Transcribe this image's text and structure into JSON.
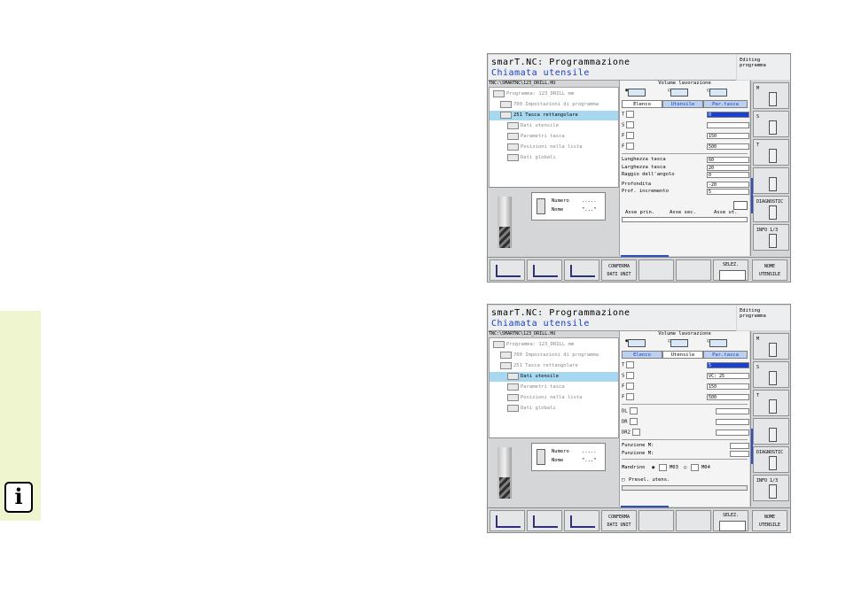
{
  "colors": {
    "sidebar": "#eef5cf",
    "accent": "#1a40c0",
    "selection": "#a8d8f0",
    "highlight_field": "#1a40d0"
  },
  "icons": [
    "info-icon",
    "tool-icon",
    "ribbon-icon",
    "spindle-icon",
    "drill-icon"
  ],
  "screens": [
    {
      "title": "smarT.NC: Programmazione",
      "subtitle": "Chiamata utensile",
      "mode": "Editing programma",
      "path": "TNC:\\SMARTNC\\123_DRILL.HU",
      "tree": [
        {
          "text": "Programma: 123_DRILL mm",
          "dim": true,
          "selected": false,
          "indent": 0
        },
        {
          "text": "700 Impostazioni di programma",
          "dim": true,
          "selected": false,
          "indent": 1
        },
        {
          "text": "251 Tasca rettangolare",
          "dim": false,
          "selected": true,
          "indent": 1
        },
        {
          "text": "Dati utensile",
          "dim": true,
          "selected": false,
          "indent": 2
        },
        {
          "text": "Parametri tasca",
          "dim": true,
          "selected": false,
          "indent": 2
        },
        {
          "text": "Posizioni nella lista",
          "dim": true,
          "selected": false,
          "indent": 2
        },
        {
          "text": "Dati globali",
          "dim": true,
          "selected": false,
          "indent": 2
        }
      ],
      "toolinfo": {
        "numero_label": "Numero",
        "numero_value": ".....",
        "nome_label": "Nome",
        "nome_value": "\"...\""
      },
      "volume_label": "Volume lavorazione",
      "tabs": [
        "Elenco",
        "Utensile",
        "Par.tasca"
      ],
      "active_tab": 0,
      "fields": [
        {
          "label": "T",
          "value": "0",
          "hl": true
        },
        {
          "label": "S",
          "value": ""
        },
        {
          "label": "F",
          "value": "150"
        },
        {
          "label": "F",
          "value": "500"
        }
      ],
      "params": [
        {
          "label": "Lunghezza tasca",
          "value": "60"
        },
        {
          "label": "Larghezza tasca",
          "value": "20"
        },
        {
          "label": "Raggio dell'angolo",
          "value": "0"
        },
        {
          "label": "Profondita",
          "value": "-20"
        },
        {
          "label": "Prof. incremento",
          "value": "5"
        }
      ],
      "axes": [
        "Asse prin.",
        "Asse sec.",
        "Asse ut."
      ],
      "right_buttons": [
        "M",
        "S",
        "T",
        "",
        "DIAGNOSTIC",
        "INFO 1/3"
      ],
      "bottom": {
        "confirm_l1": "CONFERMA",
        "confirm_l2": "DATI UNIT",
        "select": "SELEZ.",
        "name_l1": "NOME",
        "name_l2": "UTENSILE"
      }
    },
    {
      "title": "smarT.NC: Programmazione",
      "subtitle": "Chiamata utensile",
      "mode": "Editing programma",
      "path": "TNC:\\SMARTNC\\123_DRILL.HU",
      "tree": [
        {
          "text": "Programma: 123_DRILL mm",
          "dim": true,
          "selected": false,
          "indent": 0
        },
        {
          "text": "700 Impostazioni di programma",
          "dim": true,
          "selected": false,
          "indent": 1
        },
        {
          "text": "251 Tasca rettangolare",
          "dim": true,
          "selected": false,
          "indent": 1
        },
        {
          "text": "Dati utensile",
          "dim": false,
          "selected": true,
          "indent": 2
        },
        {
          "text": "Parametri tasca",
          "dim": true,
          "selected": false,
          "indent": 2
        },
        {
          "text": "Posizioni nella lista",
          "dim": true,
          "selected": false,
          "indent": 2
        },
        {
          "text": "Dati globali",
          "dim": true,
          "selected": false,
          "indent": 2
        }
      ],
      "toolinfo": {
        "numero_label": "Numero",
        "numero_value": ".....",
        "nome_label": "Nome",
        "nome_value": "\"...\""
      },
      "volume_label": "Volume lavorazione",
      "tabs": [
        "Elenco",
        "Utensile",
        "Par.tasca"
      ],
      "active_tab": 1,
      "fields": [
        {
          "label": "T",
          "value": "5",
          "hl": true
        },
        {
          "label": "S",
          "value": "VC: 25"
        },
        {
          "label": "F",
          "value": "150"
        },
        {
          "label": "F",
          "value": "500"
        }
      ],
      "offsets": [
        {
          "label": "DL"
        },
        {
          "label": "DR"
        },
        {
          "label": "DR2"
        }
      ],
      "funcs": [
        {
          "label": "Funzione M:"
        },
        {
          "label": "Funzione M:"
        }
      ],
      "spindle": {
        "label": "Mandrino",
        "opt1": "M03",
        "opt2": "M04"
      },
      "presel": "Presel. utens.",
      "right_buttons": [
        "M",
        "S",
        "T",
        "",
        "DIAGNOSTIC",
        "INFO 1/3"
      ],
      "bottom": {
        "confirm_l1": "CONFERMA",
        "confirm_l2": "DATI UNIT",
        "select": "SELEZ.",
        "name_l1": "NOME",
        "name_l2": "UTENSILE"
      }
    }
  ]
}
